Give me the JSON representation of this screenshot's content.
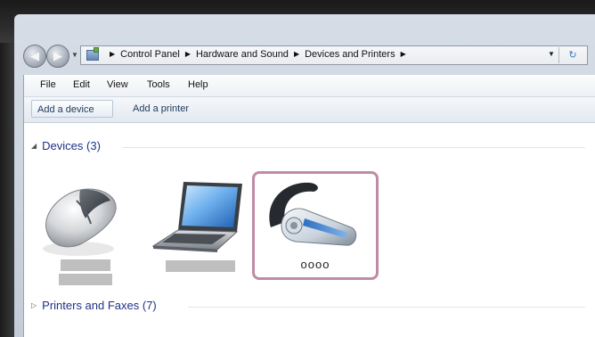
{
  "address": {
    "crumbs": [
      "Control Panel",
      "Hardware and Sound",
      "Devices and Printers"
    ]
  },
  "menu": [
    "File",
    "Edit",
    "View",
    "Tools",
    "Help"
  ],
  "commands": {
    "add_device": "Add a device",
    "add_printer": "Add a printer"
  },
  "groups": {
    "devices": "Devices (3)",
    "printers": "Printers and Faxes (7)"
  },
  "devices": {
    "headset_label": "oooo"
  }
}
